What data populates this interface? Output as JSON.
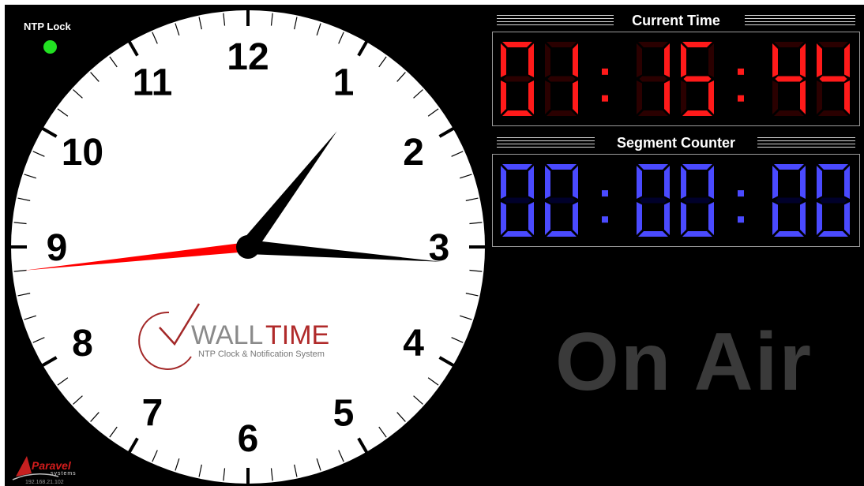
{
  "ntp": {
    "label": "NTP Lock",
    "status_color": "#22e022"
  },
  "clock": {
    "numerals": [
      "12",
      "1",
      "2",
      "3",
      "4",
      "5",
      "6",
      "7",
      "8",
      "9",
      "10",
      "11"
    ],
    "face_color": "#ffffff",
    "hand_color": "#000000",
    "second_hand_color": "#ff0000",
    "time": {
      "hours": 1,
      "minutes": 15,
      "seconds": 44
    },
    "logo": {
      "word1": "WALL",
      "word2": "TIME",
      "tagline": "NTP Clock & Notification System"
    }
  },
  "current_time": {
    "title": "Current Time",
    "digits": [
      "0",
      "1",
      "1",
      "5",
      "4",
      "4"
    ],
    "color": "#ff1a1a",
    "dim_color": "#2a0000"
  },
  "segment_counter": {
    "title": "Segment Counter",
    "digits": [
      "0",
      "0",
      "0",
      "0",
      "0",
      "0"
    ],
    "color": "#4a4aff",
    "dim_color": "#00002a"
  },
  "on_air": {
    "label": "On Air",
    "color": "#3a3a3a"
  },
  "footer": {
    "brand": "Paravel",
    "brand_sub": "systems",
    "ip": "192.168.21.102"
  }
}
